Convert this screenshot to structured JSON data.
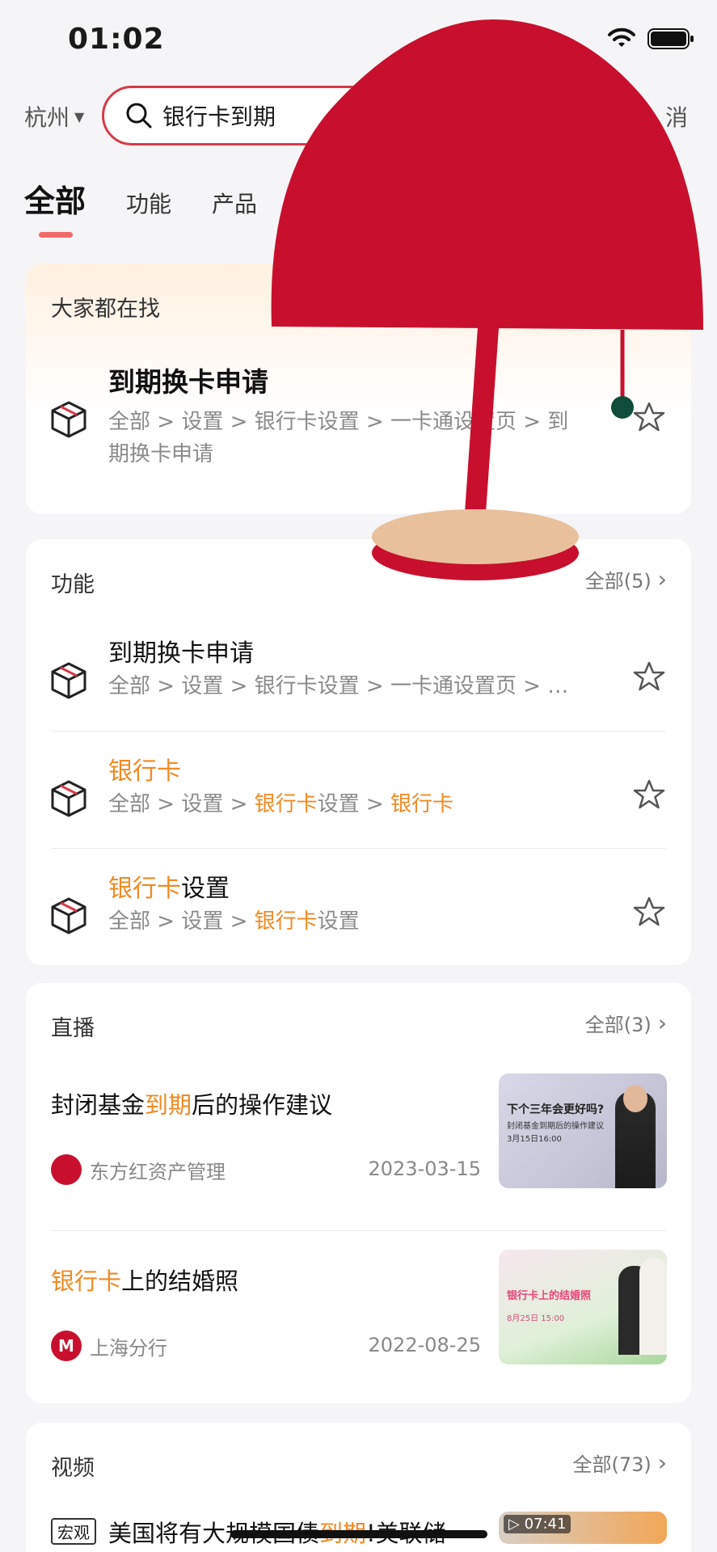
{
  "status": {
    "time": "01:02"
  },
  "search": {
    "city": "杭州",
    "query": "银行卡到期",
    "cancel_tail": "消"
  },
  "tabs": [
    {
      "label": "全部"
    },
    {
      "label": "功能"
    },
    {
      "label": "产品"
    }
  ],
  "hot": {
    "header": "大家都在找",
    "title": "到期换卡申请",
    "path_line1": "全部 > 设置 > 银行卡设置 > 一卡通设置页 > 到",
    "path_line2": "期换卡申请"
  },
  "functions": {
    "header": "功能",
    "more": "全部(5)",
    "items": [
      {
        "title": "到期换卡申请",
        "path": "全部 > 设置 > 银行卡设置 > 一卡通设置页 > …"
      },
      {
        "title_hl": "银行卡",
        "title_rest": "",
        "path_a": "全部 > 设置 > ",
        "path_hl1": "银行卡",
        "path_b": "设置 > ",
        "path_hl2": "银行卡"
      },
      {
        "title_hl": "银行卡",
        "title_rest": "设置",
        "path_a": "全部 > 设置 > ",
        "path_hl1": "银行卡",
        "path_b": "设置"
      }
    ]
  },
  "live": {
    "header": "直播",
    "more": "全部(3)",
    "items": [
      {
        "title_a": "封闭基金",
        "title_hl": "到期",
        "title_b": "后的操作建议",
        "source": "东方红资产管理",
        "date": "2023-03-15",
        "thumb_line1": "下个三年会更好吗?",
        "thumb_line2": "封闭基金到期后的操作建议",
        "thumb_line3": "3月15日16:00"
      },
      {
        "title_hl": "银行卡",
        "title_b": "上的结婚照",
        "source": "上海分行",
        "date": "2022-08-25",
        "thumb_line1": "银行卡上的结婚照",
        "thumb_line2": "8月25日 15:00"
      }
    ]
  },
  "video": {
    "header": "视频",
    "more": "全部(73)",
    "items": [
      {
        "tag": "宏观",
        "title_a": "美国将有大规模国债",
        "title_hl": "到期",
        "title_b": "!美联储",
        "duration": "07:41"
      }
    ]
  },
  "colors": {
    "accent": "#d83a48",
    "highlight": "#f08a24",
    "lamp": "#c8102e"
  }
}
